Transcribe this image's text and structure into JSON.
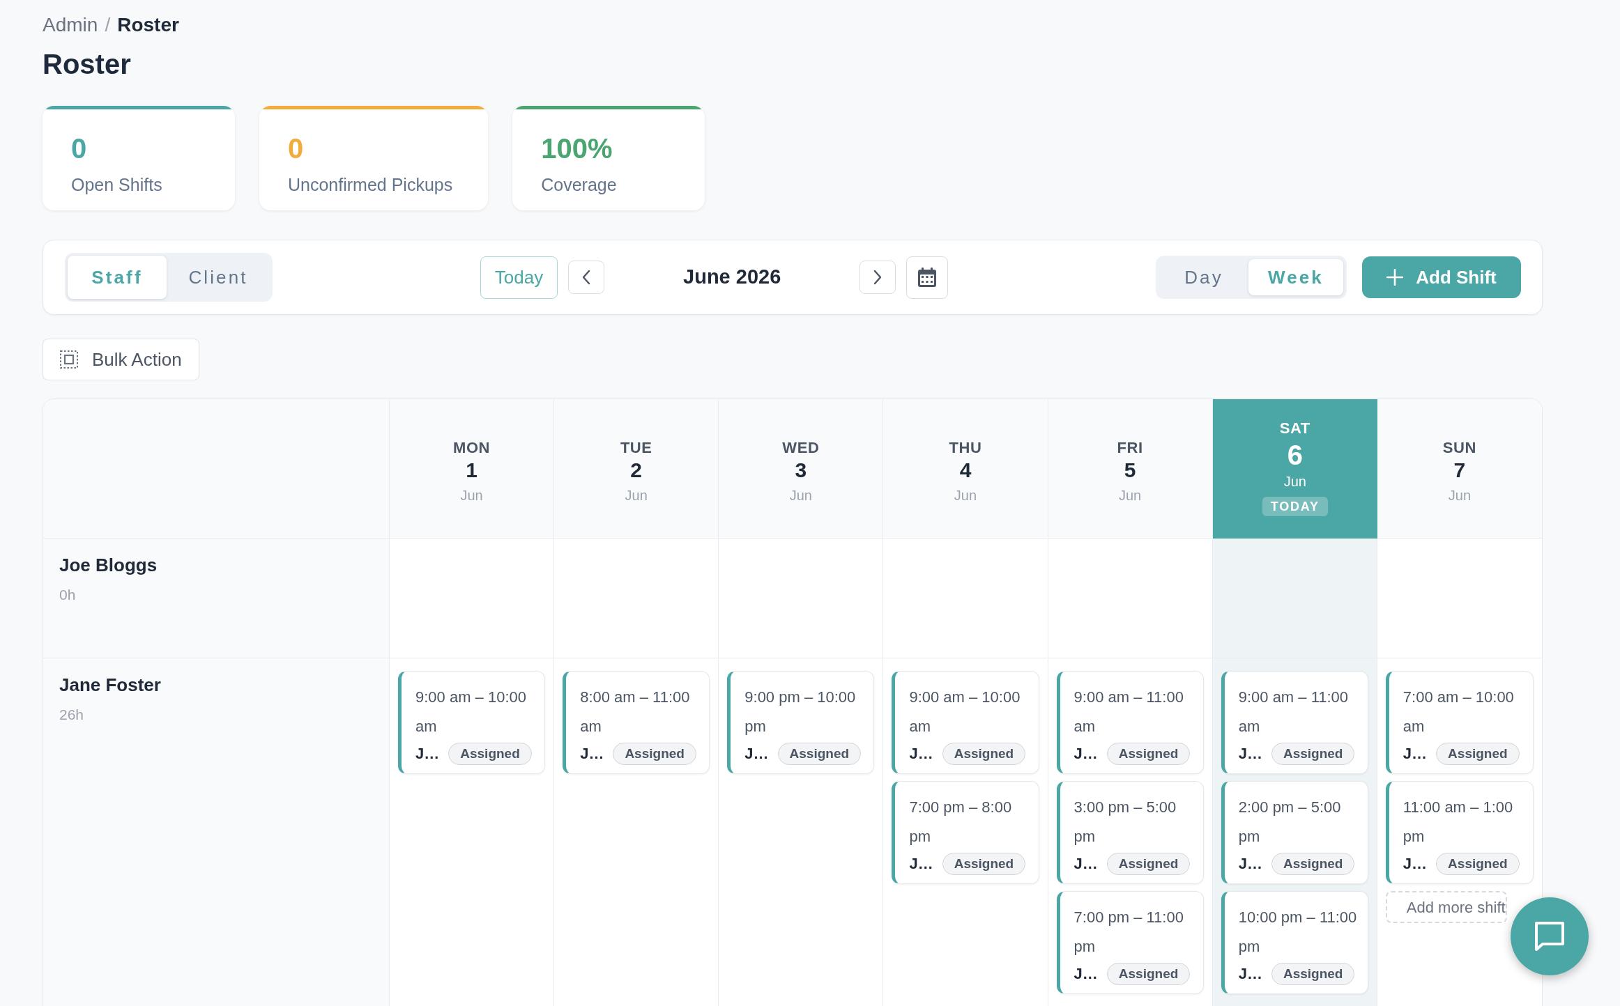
{
  "breadcrumb": {
    "separator": "/",
    "items": [
      {
        "label": "Admin",
        "current": false
      },
      {
        "label": "Roster",
        "current": true
      }
    ]
  },
  "page_title": "Roster",
  "stats": [
    {
      "value": "0",
      "label": "Open Shifts",
      "color": "#4ba6a6"
    },
    {
      "value": "0",
      "label": "Unconfirmed Pickups",
      "color": "#f2ab3c"
    },
    {
      "value": "100%",
      "label": "Coverage",
      "color": "#4aa571"
    }
  ],
  "toolbar": {
    "view_tabs": [
      {
        "label": "Staff",
        "selected": true
      },
      {
        "label": "Client",
        "selected": false
      }
    ],
    "today_button": "Today",
    "period": "June 2026",
    "range_tabs": [
      {
        "label": "Day",
        "selected": false
      },
      {
        "label": "Week",
        "selected": true
      }
    ],
    "add_button": "Add Shift"
  },
  "bulk_action_button": "Bulk Action",
  "roster": {
    "days": [
      {
        "weekday": "MON",
        "date": "1",
        "month": "Jun",
        "today": false
      },
      {
        "weekday": "TUE",
        "date": "2",
        "month": "Jun",
        "today": false
      },
      {
        "weekday": "WED",
        "date": "3",
        "month": "Jun",
        "today": false
      },
      {
        "weekday": "THU",
        "date": "4",
        "month": "Jun",
        "today": false
      },
      {
        "weekday": "FRI",
        "date": "5",
        "month": "Jun",
        "today": false
      },
      {
        "weekday": "SAT",
        "date": "6",
        "month": "Jun",
        "today": true,
        "badge": "TODAY"
      },
      {
        "weekday": "SUN",
        "date": "7",
        "month": "Jun",
        "today": false
      }
    ],
    "staff": [
      {
        "name": "Joe Bloggs",
        "hours": "0h"
      },
      {
        "name": "Jane Foster",
        "hours": "26h",
        "cells": [
          {
            "shifts": [
              {
                "time": "9:00 am – 10:00 am",
                "assignee": "J…",
                "status": "Assigned"
              }
            ]
          },
          {
            "shifts": [
              {
                "time": "8:00 am – 11:00 am",
                "assignee": "J…",
                "status": "Assigned"
              }
            ]
          },
          {
            "shifts": [
              {
                "time": "9:00 pm – 10:00 pm",
                "assignee": "J…",
                "status": "Assigned"
              }
            ]
          },
          {
            "shifts": [
              {
                "time": "9:00 am – 10:00 am",
                "assignee": "J…",
                "status": "Assigned"
              },
              {
                "time": "7:00 pm – 8:00 pm",
                "assignee": "J…",
                "status": "Assigned"
              }
            ]
          },
          {
            "shifts": [
              {
                "time": "9:00 am – 11:00 am",
                "assignee": "J…",
                "status": "Assigned"
              },
              {
                "time": "3:00 pm – 5:00 pm",
                "assignee": "J…",
                "status": "Assigned"
              },
              {
                "time": "7:00 pm – 11:00 pm",
                "assignee": "J…",
                "status": "Assigned"
              }
            ]
          },
          {
            "shifts": [
              {
                "time": "9:00 am – 11:00 am",
                "assignee": "J…",
                "status": "Assigned"
              },
              {
                "time": "2:00 pm – 5:00 pm",
                "assignee": "J…",
                "status": "Assigned"
              },
              {
                "time": "10:00 pm – 11:00 pm",
                "assignee": "J…",
                "status": "Assigned"
              }
            ]
          },
          {
            "shifts": [
              {
                "time": "7:00 am – 10:00 am",
                "assignee": "J…",
                "status": "Assigned"
              },
              {
                "time": "11:00 am – 1:00 pm",
                "assignee": "J…",
                "status": "Assigned"
              }
            ],
            "add_more": "Add more shift"
          }
        ]
      }
    ]
  }
}
